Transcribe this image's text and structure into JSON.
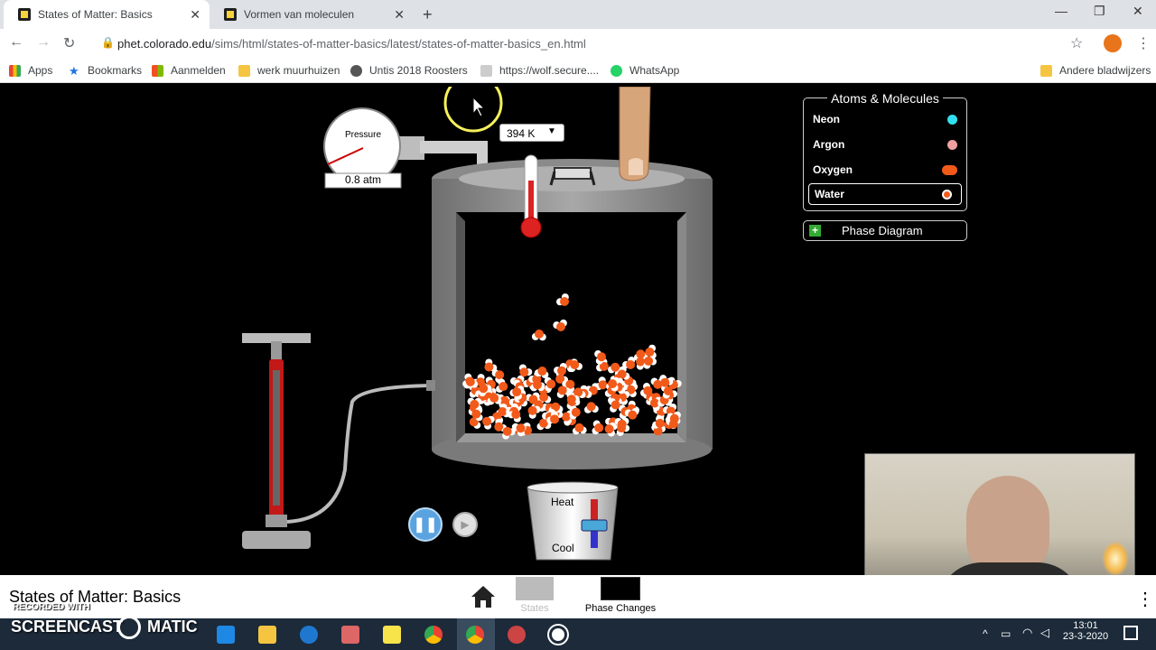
{
  "browser": {
    "tabs": [
      {
        "title": "States of Matter: Basics",
        "active": true
      },
      {
        "title": "Vormen van moleculen",
        "active": false
      }
    ],
    "url_host": "phet.colorado.edu",
    "url_path": "/sims/html/states-of-matter-basics/latest/states-of-matter-basics_en.html",
    "bookmarks": [
      "Apps",
      "Bookmarks",
      "Aanmelden",
      "werk muurhuizen",
      "Untis 2018 Roosters",
      "https://wolf.secure....",
      "WhatsApp"
    ],
    "other_bookmarks": "Andere bladwijzers"
  },
  "sim": {
    "pressure_label": "Pressure",
    "pressure_value": "0.8 atm",
    "temperature": "394 K",
    "heat_label": "Heat",
    "cool_label": "Cool",
    "atoms_title": "Atoms & Molecules",
    "atoms": [
      {
        "name": "Neon",
        "color": "#30e0f0"
      },
      {
        "name": "Argon",
        "color": "#f0a0a0"
      },
      {
        "name": "Oxygen",
        "color": "#f25a1a"
      },
      {
        "name": "Water",
        "color": "#f25a1a",
        "selected": true
      }
    ],
    "phase_diagram_label": "Phase Diagram",
    "particle_count": "approx. 120 water molecules, mostly in liquid state",
    "molecule_colors": {
      "oxygen": "#f25a1a",
      "hydrogen": "#ffffff"
    }
  },
  "bottom_bar": {
    "title": "States of Matter: Basics",
    "screens": [
      {
        "label": "States",
        "active": false
      },
      {
        "label": "Phase Changes",
        "active": true
      }
    ]
  },
  "watermark": {
    "recorded": "RECORDED WITH",
    "brand": "SCREENCAST",
    "brand2": "MATIC"
  },
  "taskbar": {
    "time": "13:01",
    "date": "23-3-2020"
  }
}
